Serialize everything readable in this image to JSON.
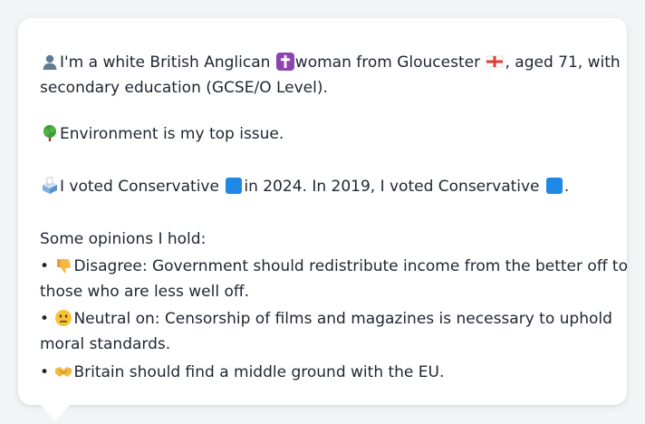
{
  "persona": {
    "intro_1": "I'm a white British Anglican",
    "intro_2": "woman from Gloucester",
    "intro_3": ", aged 71, with",
    "intro_4": "secondary education (GCSE/O Level).",
    "top_issue": "Environment is my top issue.",
    "vote_1": "I voted Conservative",
    "vote_2": "in 2024. In 2019, I voted Conservative",
    "vote_3": ".",
    "opinions_heading": "Some opinions I hold:",
    "bullet": "•",
    "opinion_1a": "Disagree: Government should redistribute income from the better off to",
    "opinion_1b": "those who are less well off.",
    "opinion_2a": "Neutral on: Censorship of films and magazines is necessary to uphold",
    "opinion_2b": "moral standards.",
    "opinion_3": "Britain should find a middle ground with the EU."
  },
  "icons": {
    "person": "person-silhouette-icon",
    "religion": "latin-cross-icon",
    "flag": "england-flag-icon",
    "issue": "deciduous-tree-icon",
    "ballot": "ballot-box-icon",
    "party": "blue-square-icon",
    "disagree": "thumbs-down-icon",
    "neutral": "neutral-face-icon",
    "middle": "handshake-icon"
  },
  "colors": {
    "party_blue": "#1e88e5",
    "cross_purple": "#8e44ad",
    "flag_red": "#e53935"
  }
}
